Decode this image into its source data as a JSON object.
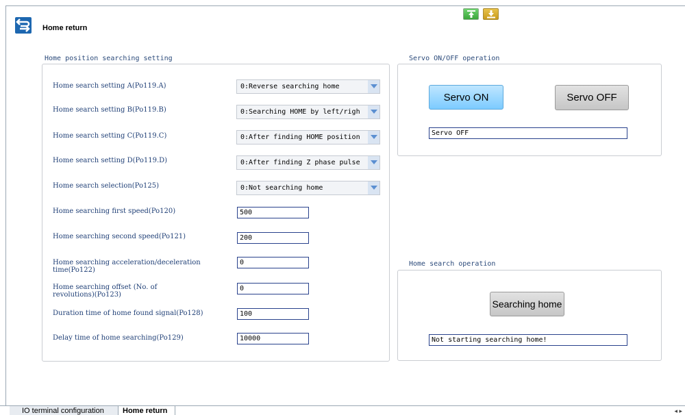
{
  "window": {
    "title": "Home return"
  },
  "toolbar": {
    "upload_icon": "upload-icon",
    "download_icon": "download-icon"
  },
  "home_setting": {
    "title": "Home position searching setting",
    "rows": [
      {
        "label": "Home search setting A(Po119.A)",
        "value": "0:Reverse searching home"
      },
      {
        "label": "Home search setting B(Po119.B)",
        "value": "0:Searching HOME by left/righ"
      },
      {
        "label": "Home search setting C(Po119.C)",
        "value": "0:After finding HOME position"
      },
      {
        "label": "Home search setting D(Po119.D)",
        "value": "0:After finding Z phase pulse"
      },
      {
        "label": "Home search selection(Po125)",
        "value": "0:Not searching home"
      }
    ],
    "fields": [
      {
        "label": "Home searching first speed(Po120)",
        "value": "500"
      },
      {
        "label": "Home searching second speed(Po121)",
        "value": "200"
      },
      {
        "label": "Home searching acceleration/deceleration time(Po122)",
        "value": "0"
      },
      {
        "label": "Home searching offset (No. of revolutions)(Po123)",
        "value": "0"
      },
      {
        "label": "Duration time of home found signal(Po128)",
        "value": "100"
      },
      {
        "label": "Delay time of home searching(Po129)",
        "value": "10000"
      }
    ]
  },
  "servo": {
    "title": "Servo ON/OFF operation",
    "on_label": "Servo ON",
    "off_label": "Servo OFF",
    "status": "Servo OFF"
  },
  "home_op": {
    "title": "Home search operation",
    "button_label": "Searching home",
    "status": "Not starting searching home!"
  },
  "tabs": [
    {
      "label": "IO terminal configuration"
    },
    {
      "label": "Home return"
    }
  ],
  "tab_nav": "◂ ▸",
  "colors": {
    "accent": "#1d67b0",
    "label_text": "#1f3f76",
    "servo_on": "#7ccbff"
  }
}
